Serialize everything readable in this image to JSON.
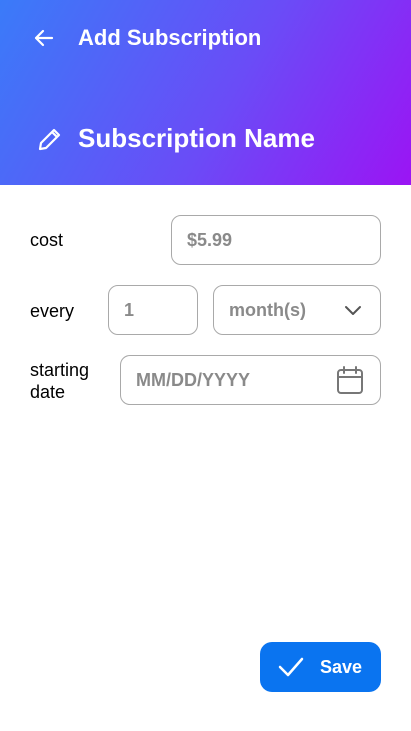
{
  "header": {
    "title": "Add Subscription",
    "subscription_name": "Subscription Name",
    "back_icon": "arrow-left-icon",
    "edit_icon": "pencil-icon"
  },
  "form": {
    "cost_label": "cost",
    "cost_placeholder": "$5.99",
    "every_label": "every",
    "interval_placeholder": "1",
    "unit_value": "month(s)",
    "unit_icon": "chevron-down-icon",
    "start_label_line1": "starting",
    "start_label_line2": "date",
    "date_placeholder": "MM/DD/YYYY",
    "date_icon": "calendar-icon"
  },
  "actions": {
    "save_label": "Save",
    "save_icon": "check-icon"
  },
  "colors": {
    "gradient_start": "#3a7bf9",
    "gradient_end": "#9b14f4",
    "accent": "#0a74f0"
  }
}
